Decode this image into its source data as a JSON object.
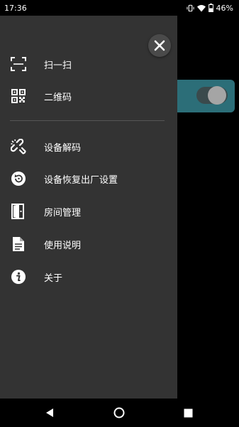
{
  "status_bar": {
    "time": "17:36",
    "battery": "46%"
  },
  "drawer": {
    "items": [
      {
        "label": "扫一扫",
        "icon": "scan-icon"
      },
      {
        "label": "二维码",
        "icon": "qr-code-icon"
      },
      {
        "label": "设备解码",
        "icon": "unlink-icon"
      },
      {
        "label": "设备恢复出厂设置",
        "icon": "restore-icon"
      },
      {
        "label": "房间管理",
        "icon": "door-icon"
      },
      {
        "label": "使用说明",
        "icon": "document-icon"
      },
      {
        "label": "关于",
        "icon": "info-icon"
      }
    ]
  },
  "colors": {
    "drawer_bg": "#333333",
    "accent": "#2c6e78"
  }
}
